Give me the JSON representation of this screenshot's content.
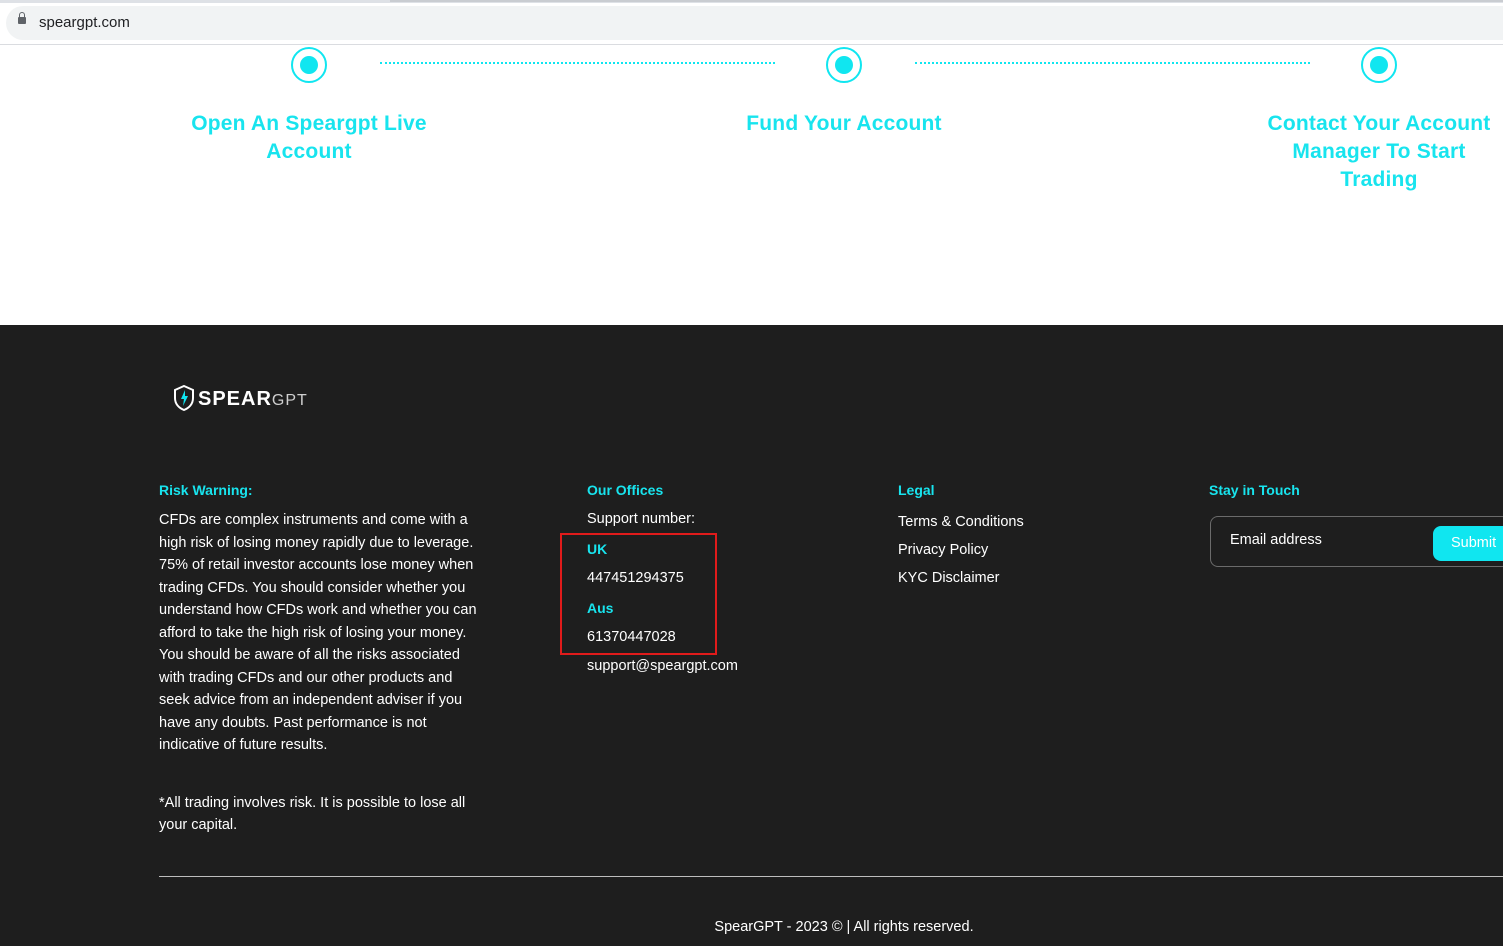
{
  "browser": {
    "url": "speargpt.com"
  },
  "steps": [
    {
      "title_line1": "Open An Speargpt Live",
      "title_line2": "Account"
    },
    {
      "title_line1": "Fund Your Account"
    },
    {
      "title_line1": "Contact Your Account",
      "title_line2": "Manager To Start",
      "title_line3": "Trading"
    }
  ],
  "footer": {
    "logo": {
      "brand": "SPEAR",
      "suffix": "GPT"
    },
    "risk": {
      "title": "Risk Warning:",
      "text": "CFDs are complex instruments and come with a high risk of losing money rapidly due to leverage. 75% of retail investor accounts lose money when trading CFDs. You should consider whether you understand how CFDs work and whether you can afford to take the high risk of losing your money. You should be aware of all the risks associated with trading CFDs and our other products and seek advice from an independent adviser if you have any doubts. Past performance is not indicative of future results.",
      "note": "*All trading involves risk. It is possible to lose all your capital."
    },
    "offices": {
      "title": "Our Offices",
      "support_label": "Support number:",
      "uk_label": "UK",
      "uk_number": "447451294375",
      "aus_label": "Aus",
      "aus_number": "61370447028",
      "email": "support@speargpt.com"
    },
    "legal": {
      "title": "Legal",
      "links": [
        "Terms & Conditions",
        "Privacy Policy",
        "KYC Disclaimer"
      ]
    },
    "newsletter": {
      "title": "Stay in Touch",
      "placeholder": "Email address",
      "submit_label": "Submit"
    },
    "copyright": "SpearGPT - 2023 © | All rights reserved."
  },
  "colors": {
    "accent": "#10e6f0",
    "footer_bg": "#1e1e1e",
    "highlight_box": "#e01b1b"
  }
}
